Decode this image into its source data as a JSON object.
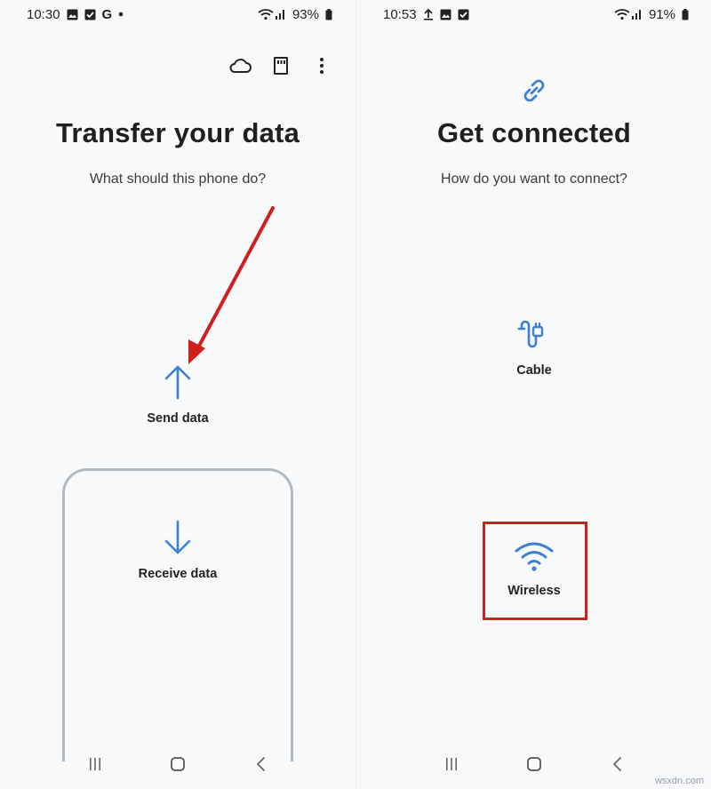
{
  "colors": {
    "accent_blue": "#3b7fd6",
    "annotation_red": "#d01f1f",
    "selected_frame": "#b3bac2"
  },
  "left_screen": {
    "status_bar": {
      "time": "10:30",
      "notification_icons": [
        "image-icon",
        "check-box-icon",
        "google-g-icon",
        "dot-icon"
      ],
      "google_letter": "G",
      "battery": "93%"
    },
    "toolbar": {
      "icons": [
        "cloud-icon",
        "sd-card-icon",
        "more-vertical-icon"
      ]
    },
    "title": "Transfer your data",
    "subtitle": "What should this phone do?",
    "options": [
      {
        "label": "Send data",
        "icon": "arrow-up-icon"
      },
      {
        "label": "Receive data",
        "icon": "arrow-down-icon"
      }
    ],
    "annotation": "red-arrow-pointing-to-send-data"
  },
  "right_screen": {
    "status_bar": {
      "time": "10:53",
      "notification_icons": [
        "upload-icon",
        "image-icon",
        "check-box-icon"
      ],
      "battery": "91%"
    },
    "header_icon": "link-icon",
    "title": "Get connected",
    "subtitle": "How do you want to connect?",
    "options": [
      {
        "label": "Cable",
        "icon": "usb-cable-icon"
      },
      {
        "label": "Wireless",
        "icon": "wifi-icon"
      }
    ],
    "annotation": "red-box-around-wireless"
  },
  "nav_bar": {
    "buttons": [
      "recent-apps-icon",
      "home-icon",
      "back-icon"
    ]
  },
  "watermark": "wsxdn.com"
}
